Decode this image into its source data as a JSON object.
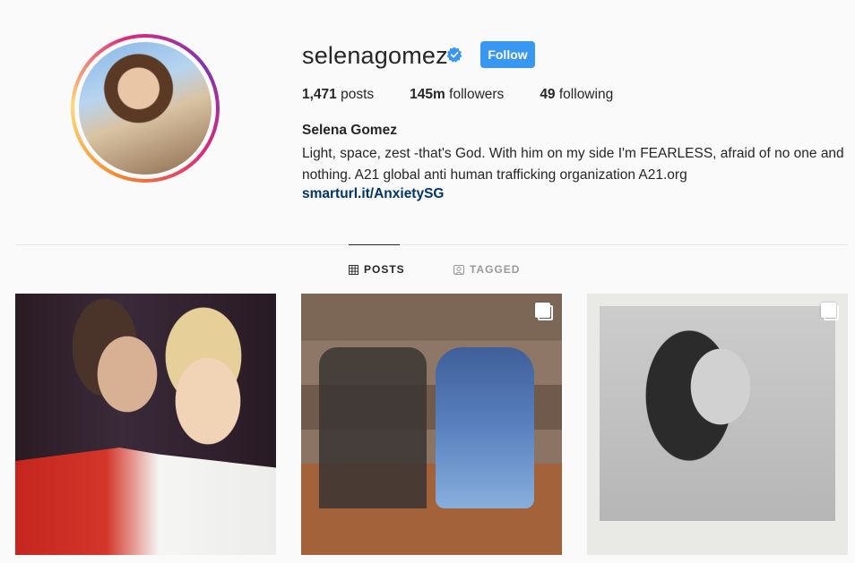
{
  "profile": {
    "username": "selenagomez",
    "verified": true,
    "follow_label": "Follow",
    "full_name": "Selena Gomez",
    "bio_line_1": "Light, space, zest -that's God. With him on my side I'm FEARLESS, afraid of no one and",
    "bio_line_2": "nothing. A21 global anti human trafficking organization A21.org",
    "link": "smarturl.it/AnxietySG"
  },
  "stats": {
    "posts_count": "1,471",
    "posts_label": "posts",
    "followers_count": "145m",
    "followers_label": "followers",
    "following_count": "49",
    "following_label": "following"
  },
  "tabs": [
    {
      "label": "POSTS",
      "icon": "grid-icon",
      "active": true
    },
    {
      "label": "TAGGED",
      "icon": "tagged-icon",
      "active": false
    }
  ],
  "posts": [
    {
      "multi": false
    },
    {
      "multi": true
    },
    {
      "multi": true
    }
  ],
  "colors": {
    "accent": "#3897f0",
    "link": "#003569",
    "text": "#262626",
    "muted": "#999999",
    "background": "#fafafa"
  }
}
